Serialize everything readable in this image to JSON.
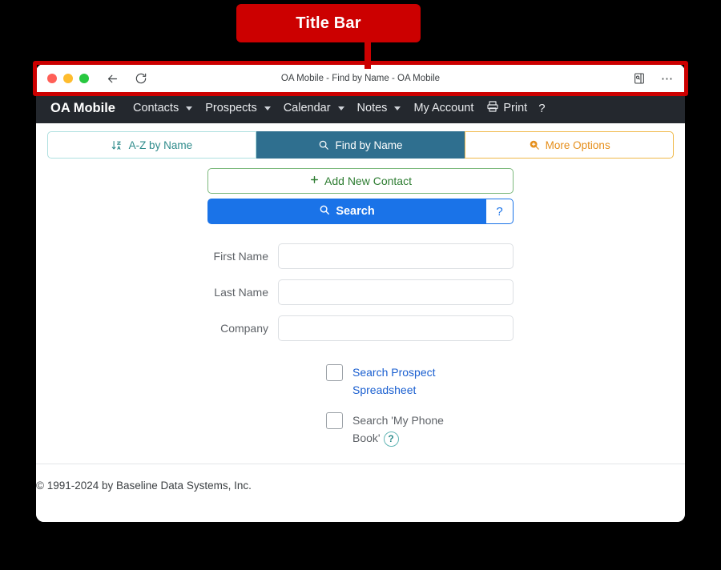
{
  "annotation": {
    "label": "Title Bar",
    "color": "#cc0000"
  },
  "browser": {
    "title": "OA Mobile - Find by Name - OA Mobile",
    "back_icon": "back-arrow-icon",
    "reload_icon": "reload-icon",
    "reading_view_icon": "reading-view-icon",
    "more_icon": "ellipsis-icon",
    "traffic_lights": [
      "close-red",
      "minimize-yellow",
      "maximize-green"
    ]
  },
  "appnav": {
    "brand": "OA Mobile",
    "items": [
      {
        "label": "Contacts",
        "has_caret": true
      },
      {
        "label": "Prospects",
        "has_caret": true
      },
      {
        "label": "Calendar",
        "has_caret": true
      },
      {
        "label": "Notes",
        "has_caret": true
      },
      {
        "label": "My Account",
        "has_caret": false
      }
    ],
    "print_label": "Print",
    "help_label": "?"
  },
  "tabs": [
    {
      "label": "A-Z by Name",
      "icon": "sort-alpha-down-icon",
      "active": false,
      "color": "#2e8b8b"
    },
    {
      "label": "Find by Name",
      "icon": "search-icon",
      "active": true,
      "color": "#2f6f8f"
    },
    {
      "label": "More Options",
      "icon": "search-plus-icon",
      "active": false,
      "color": "#e58e1a"
    }
  ],
  "actions": {
    "add_contact_label": "Add New Contact",
    "add_contact_icon": "plus-icon",
    "search_label": "Search",
    "search_icon": "search-icon",
    "search_help_label": "?"
  },
  "form": {
    "fields": [
      {
        "label": "First Name",
        "value": "",
        "placeholder": ""
      },
      {
        "label": "Last Name",
        "value": "",
        "placeholder": ""
      },
      {
        "label": "Company",
        "value": "",
        "placeholder": ""
      }
    ]
  },
  "checkboxes": [
    {
      "label": "Search Prospect Spreadsheet",
      "checked": false,
      "style": "link",
      "help": false
    },
    {
      "label": "Search 'My Phone Book'",
      "checked": false,
      "style": "plain",
      "help": true,
      "help_label": "?"
    }
  ],
  "footer": {
    "copyright": "© 1991-2024 by Baseline Data Systems, Inc."
  }
}
